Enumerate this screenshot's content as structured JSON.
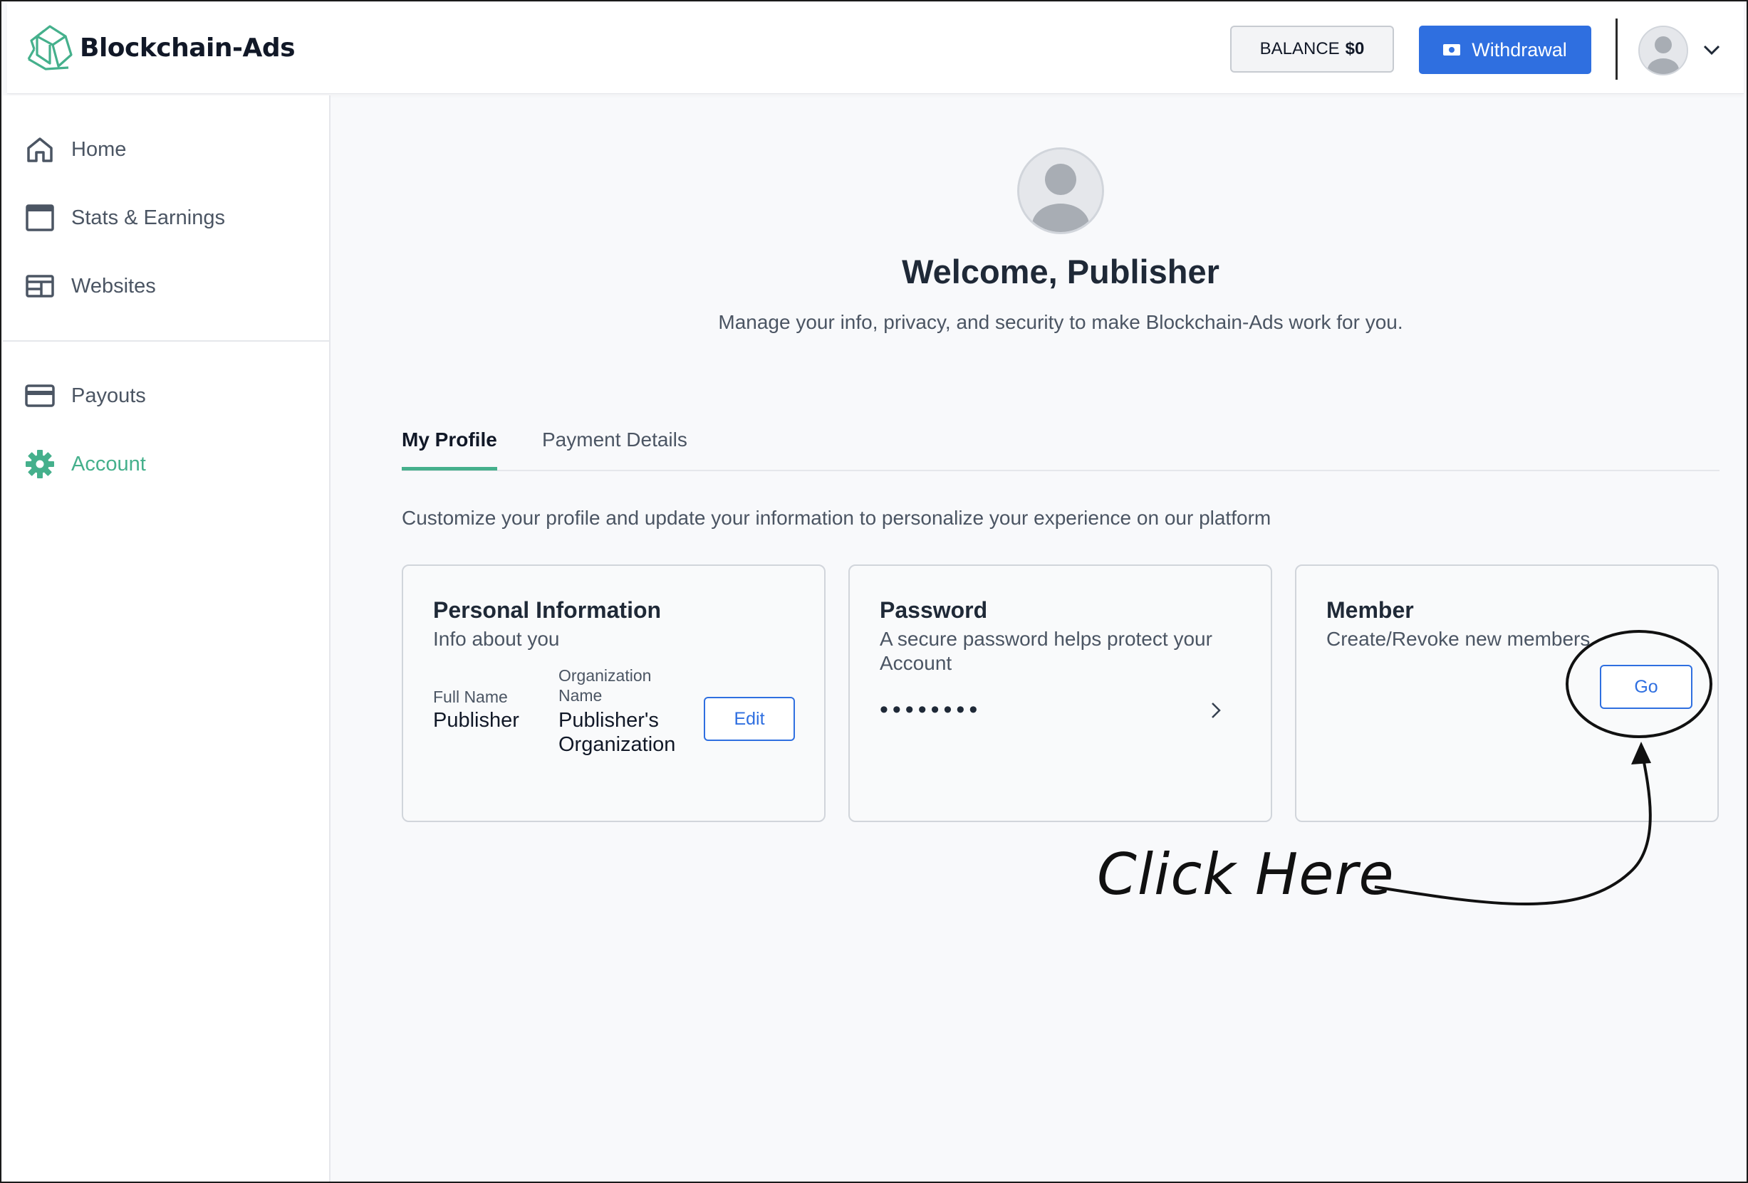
{
  "header": {
    "brand": "Blockchain-Ads",
    "balance_label": "BALANCE",
    "balance_amount": "$0",
    "withdraw_label": "Withdrawal"
  },
  "sidebar": {
    "items": [
      {
        "label": "Home",
        "icon": "home-icon"
      },
      {
        "label": "Stats & Earnings",
        "icon": "window-icon"
      },
      {
        "label": "Websites",
        "icon": "layout-icon"
      },
      {
        "label": "Payouts",
        "icon": "credit-card-icon"
      },
      {
        "label": "Account",
        "icon": "gear-icon",
        "active": true
      }
    ]
  },
  "main": {
    "welcome": "Welcome, Publisher",
    "subtitle": "Manage your info, privacy, and security to make Blockchain-Ads work for you.",
    "tabs": [
      {
        "label": "My Profile",
        "active": true
      },
      {
        "label": "Payment Details"
      }
    ],
    "intro": "Customize your profile and update your information to personalize your experience on our platform",
    "personal": {
      "title": "Personal Information",
      "subtitle": "Info about you",
      "full_name_label": "Full Name",
      "full_name": "Publisher",
      "org_label": "Organization Name",
      "org_name": "Publisher's Organization",
      "edit_label": "Edit"
    },
    "password": {
      "title": "Password",
      "subtitle": "A secure password helps protect your Account",
      "masked": "••••••••"
    },
    "member": {
      "title": "Member",
      "subtitle": "Create/Revoke new members",
      "go_label": "Go"
    }
  },
  "annotation": {
    "text": "Click Here"
  },
  "colors": {
    "accent_green": "#45b08c",
    "primary_blue": "#2f6fe0"
  }
}
